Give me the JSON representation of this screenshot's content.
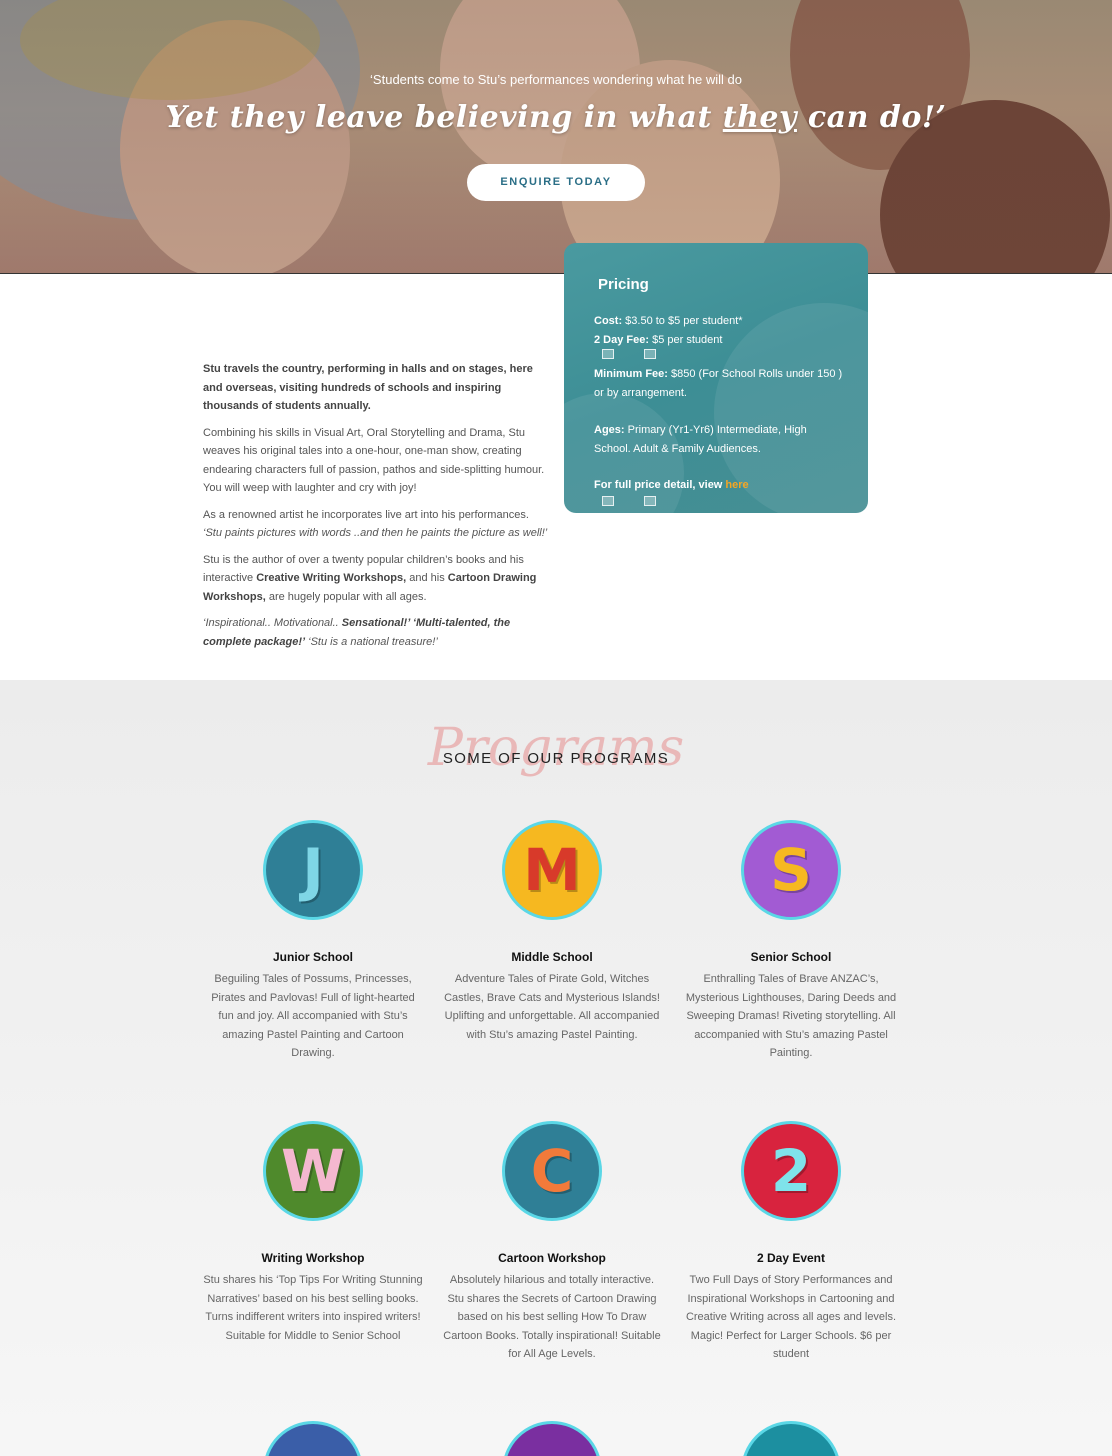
{
  "hero": {
    "quote": "‘Students come to Stu’s performances wondering what he will do",
    "script_pre": "Yet they leave believing in what ",
    "script_emph": "they",
    "script_post": " can do!’",
    "button": "ENQUIRE TODAY"
  },
  "pricing": {
    "title": "Pricing",
    "cost_label": "Cost:",
    "cost_value": " $3.50 to $5 per student*",
    "day_label": "2 Day Fee:",
    "day_value": " $5 per student",
    "min_label": "Minimum Fee:",
    "min_value": " $850 (For School Rolls under 150 ) or by arrangement.",
    "ages_label": "Ages:",
    "ages_value": " Primary (Yr1-Yr6) Intermediate, High School. Adult & Family Audiences.",
    "full_label": "For full price detail, view ",
    "full_link": "here"
  },
  "intro": {
    "p1": "Stu travels the country, performing in halls and on stages, here and overseas, visiting hundreds of schools and inspiring thousands of students annually.",
    "p2": "Combining his skills in Visual Art, Oral Storytelling and Drama, Stu weaves his original tales into a one-hour, one-man show, creating endearing characters full of passion, pathos and side-splitting humour. You will weep with laughter and cry with joy!",
    "p3a": "As a renowned artist he incorporates live art into his performances.",
    "p3b": "‘Stu paints pictures with words ..and then he paints the picture as well!’",
    "p4a": "Stu is the author of over a twenty popular children’s books and his interactive ",
    "p4b": "Creative Writing Workshops,",
    "p4c": " and his ",
    "p4d": "Cartoon Drawing Workshops,",
    "p4e": " are hugely popular with all ages.",
    "p5a": "‘Inspirational.. Motivational.. ",
    "p5b": "Sensational!’",
    "p5c": "  ‘Multi-talented, the complete package!’",
    "p5d": "  ‘Stu is a national treasure!’"
  },
  "programs": {
    "script": "Programs",
    "title": "SOME OF OUR PROGRAMS",
    "items": [
      {
        "letter": "J",
        "name": "Junior School",
        "desc": "Beguiling Tales of Possums, Princesses, Pirates and Pavlovas! Full of light-hearted fun and joy. All accompanied with Stu’s amazing Pastel Painting and Cartoon Drawing.",
        "bg": "#2f7f96",
        "fg": "#7fd6e6"
      },
      {
        "letter": "M",
        "name": "Middle School",
        "desc": "Adventure Tales of Pirate Gold, Witches Castles, Brave Cats and Mysterious Islands! Uplifting and unforgettable. All accompanied with Stu’s amazing Pastel Painting.",
        "bg": "#f6b820",
        "fg": "#d83a2a"
      },
      {
        "letter": "S",
        "name": "Senior School",
        "desc": "Enthralling Tales of Brave ANZAC’s, Mysterious Lighthouses, Daring Deeds and Sweeping Dramas! Riveting storytelling. All accompanied with Stu’s amazing Pastel Painting.",
        "bg": "#a25bd3",
        "fg": "#f6b820"
      },
      {
        "letter": "W",
        "name": "Writing Workshop",
        "desc": "Stu shares his ‘Top Tips For Writing Stunning Narratives’ based on his best selling books. Turns indifferent writers into inspired writers! Suitable for Middle to Senior School",
        "bg": "#4f8a2c",
        "fg": "#f4b8cf"
      },
      {
        "letter": "C",
        "name": "Cartoon Workshop",
        "desc": "Absolutely hilarious and totally interactive. Stu shares the Secrets of Cartoon Drawing based on his best selling How To Draw Cartoon Books. Totally inspirational! Suitable for All Age Levels.",
        "bg": "#2f7f96",
        "fg": "#f27a3a"
      },
      {
        "letter": "2",
        "name": "2 Day Event",
        "desc": "Two Full Days of Story Performances and Inspirational Workshops in Cartooning and Creative Writing across all ages and levels. Magic! Perfect for Larger Schools. $6 per student",
        "bg": "#d8233e",
        "fg": "#7fe3ea"
      }
    ],
    "more": [
      {
        "bg": "#3a5ea8"
      },
      {
        "bg": "#7a2fa0"
      },
      {
        "bg": "#1c8fa0"
      }
    ]
  },
  "colors": {
    "accent": "#2a6e86",
    "pricing_bg": "#428f95",
    "link": "#f5a623",
    "badge_ring": "#5ad7e6"
  }
}
